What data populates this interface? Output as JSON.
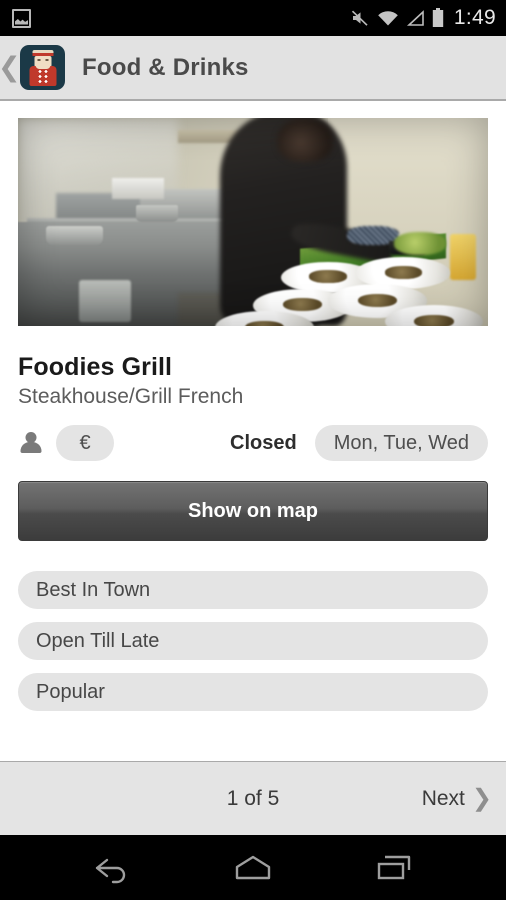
{
  "statusbar": {
    "notification_icon": "screenshot-icon",
    "icons": [
      "mute-icon",
      "wifi-icon",
      "signal-icon",
      "battery-icon"
    ],
    "clock": "1:49"
  },
  "actionbar": {
    "back_icon": "back-chevron-icon",
    "app_icon": "bellhop-app-icon",
    "title": "Food & Drinks"
  },
  "listing": {
    "photo_alt": "restaurant-kitchen-photo",
    "name": "Foodies Grill",
    "category": "Steakhouse/Grill French",
    "person_icon": "person-icon",
    "price_level": "€",
    "status": "Closed",
    "closed_days": "Mon, Tue, Wed",
    "map_button": "Show on map",
    "tags": [
      "Best In Town",
      "Open Till Late",
      "Popular"
    ]
  },
  "footer": {
    "page_indicator": "1 of 5",
    "next_label": "Next",
    "next_icon": "chevron-right-icon"
  },
  "navbar": {
    "back": "back-icon",
    "home": "home-icon",
    "recents": "recents-icon"
  },
  "colors": {
    "status_bar": "#000000",
    "action_bar": "#e2e2e2",
    "pill": "#e4e4e4",
    "button_top": "#737373",
    "button_bottom": "#3c3c3c",
    "app_icon_bg": "#1b3947",
    "app_icon_red": "#c0392b"
  }
}
